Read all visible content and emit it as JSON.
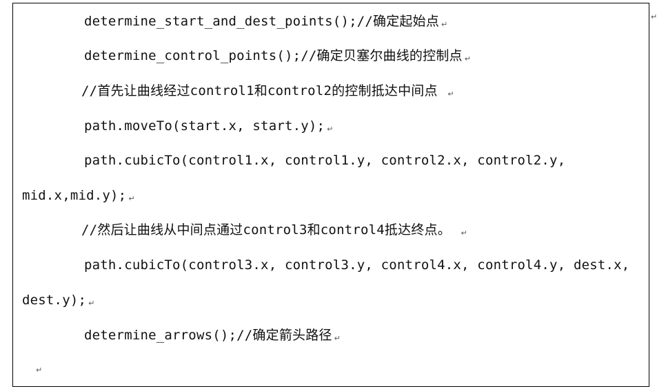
{
  "paragraph_mark": "↵",
  "lines": [
    {
      "code": "determine_start_and_dest_points();//",
      "comment": "确定起始点"
    },
    {
      "code": "determine_control_points();//",
      "comment": "确定贝塞尔曲线的控制点"
    },
    {
      "text": "//首先让曲线经过control1和control2的控制抵达中间点 "
    },
    {
      "code": "path.moveTo(start.x, start.y);"
    },
    {
      "code": "path.cubicTo(control1.x, control1.y, control2.x, control2.y,"
    },
    {
      "code": "mid.x,mid.y);"
    },
    {
      "text": "//然后让曲线从中间点通过control3和control4抵达终点。 "
    },
    {
      "code": "path.cubicTo(control3.x, control3.y, control4.x, control4.y, dest.x,"
    },
    {
      "code": "dest.y);"
    },
    {
      "code": "determine_arrows();//",
      "comment": "确定箭头路径"
    }
  ]
}
